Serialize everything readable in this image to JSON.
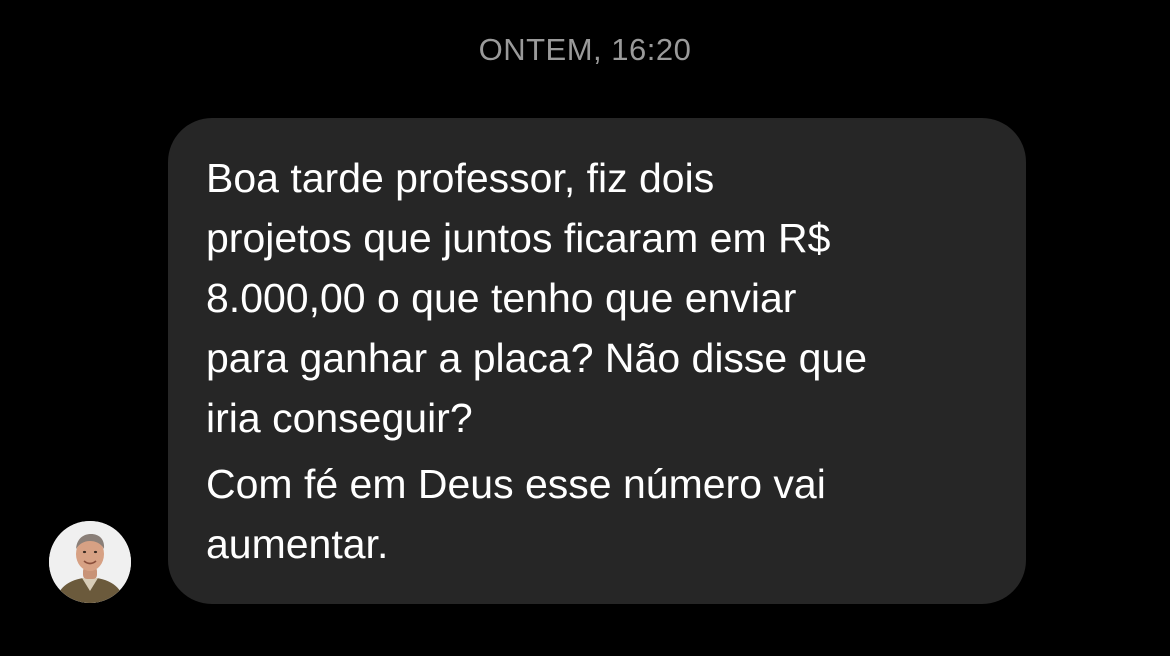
{
  "conversation": {
    "timestamp": "ONTEM, 16:20"
  },
  "message": {
    "lines": [
      "Boa tarde professor,  fiz dois",
      "projetos que juntos ficaram em R$",
      "8.000,00 o que tenho que enviar",
      "para ganhar a placa? Não disse que",
      "iria conseguir?",
      "Com fé em Deus esse número vai",
      "aumentar."
    ]
  },
  "sender": {
    "avatar_icon": "user-photo-avatar"
  },
  "colors": {
    "background": "#000000",
    "bubble": "#262626",
    "timestamp_text": "#9a9a9a",
    "message_text": "#ffffff"
  }
}
